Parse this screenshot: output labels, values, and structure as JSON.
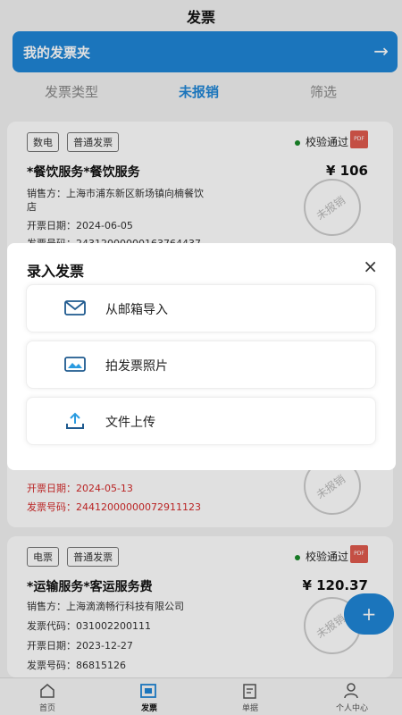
{
  "nav": {
    "title": "发票"
  },
  "folder": {
    "label": "我的发票夹",
    "arrow": "→"
  },
  "tabs": [
    {
      "label": "发票类型"
    },
    {
      "label": "未报销"
    },
    {
      "label": "筛选"
    }
  ],
  "cards": [
    {
      "tags": [
        "数电",
        "普通发票"
      ],
      "status": "校验通过",
      "pdf": "PDF",
      "title": "*餐饮服务*餐饮服务",
      "amount": "¥ 106",
      "seller_line1": "销售方：上海市浦东新区新场镇向楠餐饮",
      "seller_line2": "店",
      "date": "开票日期：2024-06-05",
      "number": "发票号码：24312000000163764437",
      "stamp": "未报销"
    },
    {
      "date": "开票日期：2024-05-13",
      "number": "发票号码：24412000000072911123",
      "stamp": "未报销"
    },
    {
      "tags": [
        "电票",
        "普通发票"
      ],
      "status": "校验通过",
      "pdf": "PDF",
      "title": "*运输服务*客运服务费",
      "amount": "¥ 120.37",
      "seller": "销售方：上海滴滴畅行科技有限公司",
      "code": "发票代码：031002200111",
      "date": "开票日期：2023-12-27",
      "number": "发票号码：86815126",
      "stamp": "未报销"
    }
  ],
  "fab": {
    "label": "+"
  },
  "tabbar": [
    {
      "label": "首页",
      "icon": "home-icon"
    },
    {
      "label": "发票",
      "icon": "invoice-icon"
    },
    {
      "label": "单据",
      "icon": "document-icon"
    },
    {
      "label": "个人中心",
      "icon": "user-icon"
    }
  ],
  "sheet": {
    "title": "录入发票",
    "close": "×",
    "options": [
      {
        "label": "从邮箱导入",
        "icon": "mail-icon"
      },
      {
        "label": "拍发票照片",
        "icon": "image-icon"
      },
      {
        "label": "文件上传",
        "icon": "upload-icon"
      }
    ]
  },
  "colors": {
    "accent": "#1f86d6",
    "verified": "#1a8a2a",
    "red_text": "#d42a2a"
  }
}
